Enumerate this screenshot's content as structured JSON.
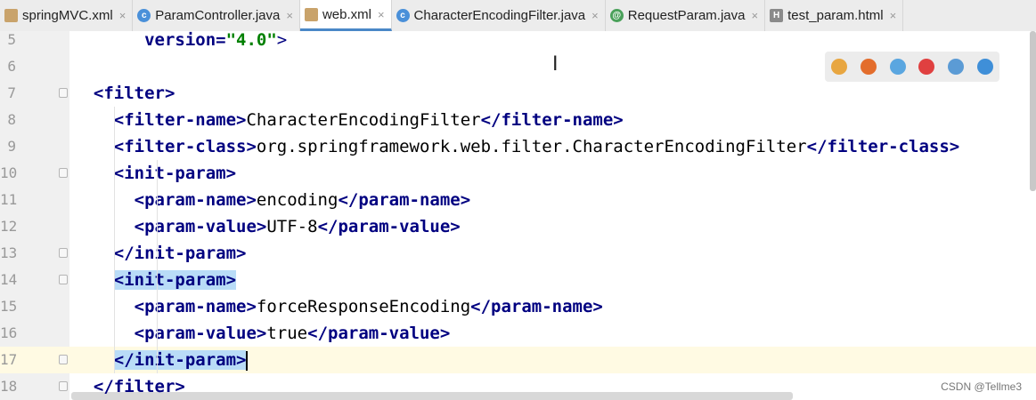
{
  "tabs": [
    {
      "label": "springMVC.xml",
      "icon": "xml-file-icon",
      "active": false
    },
    {
      "label": "ParamController.java",
      "icon": "java-class-icon",
      "active": false
    },
    {
      "label": "web.xml",
      "icon": "xml-file-icon",
      "active": true
    },
    {
      "label": "CharacterEncodingFilter.java",
      "icon": "java-class-icon",
      "active": false
    },
    {
      "label": "RequestParam.java",
      "icon": "annotation-icon",
      "active": false
    },
    {
      "label": "test_param.html",
      "icon": "html-file-icon",
      "active": false
    }
  ],
  "close_glyph": "×",
  "lines": [
    {
      "num": "5",
      "indent": "       ",
      "segments": [
        {
          "t": "version=",
          "c": "tag"
        },
        {
          "t": "\"4.0\"",
          "c": "str"
        },
        {
          "t": ">",
          "c": "br"
        }
      ]
    },
    {
      "num": "6",
      "indent": "",
      "segments": []
    },
    {
      "num": "7",
      "indent": "  ",
      "segments": [
        {
          "t": "<filter>",
          "c": "tag"
        }
      ]
    },
    {
      "num": "8",
      "indent": "    ",
      "segments": [
        {
          "t": "<filter-name>",
          "c": "tag"
        },
        {
          "t": "CharacterEncodingFilter",
          "c": "txt"
        },
        {
          "t": "</filter-name>",
          "c": "tag"
        }
      ]
    },
    {
      "num": "9",
      "indent": "    ",
      "segments": [
        {
          "t": "<filter-class>",
          "c": "tag"
        },
        {
          "t": "org.springframework.web.filter.CharacterEncodingFilter",
          "c": "txt"
        },
        {
          "t": "</filter-class>",
          "c": "tag"
        }
      ]
    },
    {
      "num": "10",
      "indent": "    ",
      "segments": [
        {
          "t": "<init-param>",
          "c": "tag"
        }
      ]
    },
    {
      "num": "11",
      "indent": "      ",
      "segments": [
        {
          "t": "<param-name>",
          "c": "tag"
        },
        {
          "t": "encoding",
          "c": "txt"
        },
        {
          "t": "</param-name>",
          "c": "tag"
        }
      ]
    },
    {
      "num": "12",
      "indent": "      ",
      "segments": [
        {
          "t": "<param-value>",
          "c": "tag"
        },
        {
          "t": "UTF-8",
          "c": "txt"
        },
        {
          "t": "</param-value>",
          "c": "tag"
        }
      ]
    },
    {
      "num": "13",
      "indent": "    ",
      "segments": [
        {
          "t": "</init-param>",
          "c": "tag"
        }
      ]
    },
    {
      "num": "14",
      "indent": "    ",
      "segments": [
        {
          "t": "<init-param>",
          "c": "tag hl"
        }
      ]
    },
    {
      "num": "15",
      "indent": "      ",
      "segments": [
        {
          "t": "<param-name>",
          "c": "tag"
        },
        {
          "t": "forceResponseEncoding",
          "c": "txt"
        },
        {
          "t": "</param-name>",
          "c": "tag"
        }
      ]
    },
    {
      "num": "16",
      "indent": "      ",
      "segments": [
        {
          "t": "<param-value>",
          "c": "tag"
        },
        {
          "t": "true",
          "c": "txt"
        },
        {
          "t": "</param-value>",
          "c": "tag"
        }
      ]
    },
    {
      "num": "17",
      "indent": "    ",
      "segments": [
        {
          "t": "</init-param>",
          "c": "tag hl"
        }
      ],
      "current": true
    },
    {
      "num": "18",
      "indent": "  ",
      "segments": [
        {
          "t": "</filter>",
          "c": "tag"
        }
      ]
    }
  ],
  "browser_icons": [
    "chrome-icon",
    "firefox-icon",
    "safari-icon",
    "opera-icon",
    "ie-icon",
    "edge-icon"
  ],
  "browser_colors": [
    "#e8a640",
    "#e36d2c",
    "#5aa6e0",
    "#e04040",
    "#5b9bd5",
    "#3f8fd8"
  ],
  "watermark": "CSDN @Tellme3"
}
